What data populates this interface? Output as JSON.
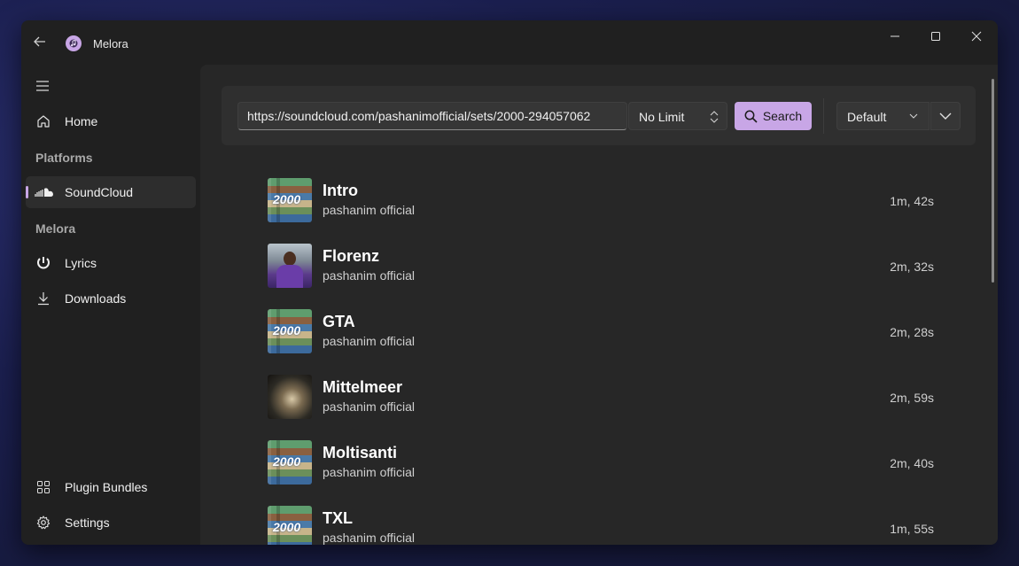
{
  "window": {
    "title": "Melora",
    "controls": {
      "minimize": "minimize-icon",
      "maximize": "maximize-icon",
      "close": "close-icon"
    }
  },
  "sidebar": {
    "home": {
      "label": "Home",
      "icon": "home-icon"
    },
    "platforms_header": "Platforms",
    "soundcloud": {
      "label": "SoundCloud",
      "icon": "soundcloud-icon",
      "active": true
    },
    "melora_header": "Melora",
    "lyrics": {
      "label": "Lyrics",
      "icon": "lyrics-icon"
    },
    "downloads": {
      "label": "Downloads",
      "icon": "download-icon"
    },
    "plugin_bundles": {
      "label": "Plugin Bundles",
      "icon": "grid-icon"
    },
    "settings": {
      "label": "Settings",
      "icon": "gear-icon"
    }
  },
  "search": {
    "url": "https://soundcloud.com/pashanimofficial/sets/2000-294057062",
    "limit": "No Limit",
    "button_label": "Search",
    "sort": "Default",
    "accent_color": "#c8a6e6"
  },
  "tracks": [
    {
      "title": "Intro",
      "artist": "pashanim official",
      "duration": "1m, 42s",
      "cover": "2000"
    },
    {
      "title": "Florenz",
      "artist": "pashanim official",
      "duration": "2m, 32s",
      "cover": "florenz"
    },
    {
      "title": "GTA",
      "artist": "pashanim official",
      "duration": "2m, 28s",
      "cover": "2000"
    },
    {
      "title": "Mittelmeer",
      "artist": "pashanim official",
      "duration": "2m, 59s",
      "cover": "mittelmeer"
    },
    {
      "title": "Moltisanti",
      "artist": "pashanim official",
      "duration": "2m, 40s",
      "cover": "2000"
    },
    {
      "title": "TXL",
      "artist": "pashanim official",
      "duration": "1m, 55s",
      "cover": "2000"
    }
  ]
}
